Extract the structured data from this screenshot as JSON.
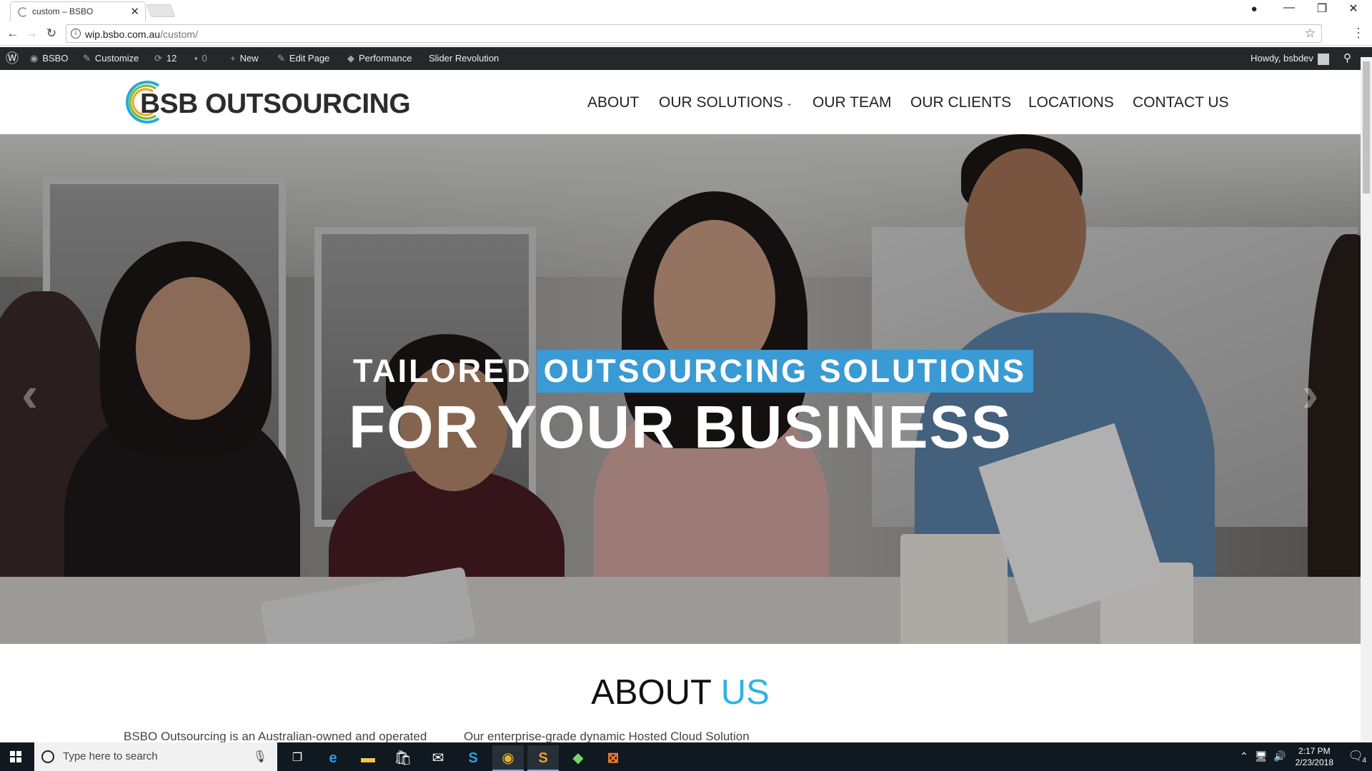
{
  "browser": {
    "tab_title": "custom – BSBO",
    "tab_close": "✕",
    "url_host": "wip.bsbo.com.au",
    "url_path": "/custom/",
    "window_controls": [
      "—",
      "❐",
      "✕"
    ]
  },
  "adminbar": {
    "site": "BSBO",
    "customize": "Customize",
    "updates": "12",
    "comments": "0",
    "new": "New",
    "edit_page": "Edit Page",
    "performance": "Performance",
    "slider_revolution": "Slider Revolution",
    "howdy": "Howdy, bsbdev"
  },
  "header": {
    "logo_text": "BSB OUTSOURCING",
    "nav": [
      "ABOUT",
      "OUR SOLUTIONS",
      "OUR TEAM",
      "OUR CLIENTS",
      "LOCATIONS",
      "CONTACT US"
    ],
    "dropdown_chevron": "⌄"
  },
  "hero": {
    "line1_prefix": "TAILORED",
    "line1_highlight": "OUTSOURCING SOLUTIONS",
    "line2": "FOR YOUR BUSINESS",
    "prev": "‹",
    "next": "›"
  },
  "about": {
    "title_part1": "ABOUT",
    "title_part2": "US",
    "col1": "BSBO Outsourcing is an Australian-owned and operated",
    "col2": "Our enterprise-grade dynamic Hosted Cloud Solution"
  },
  "taskbar": {
    "search_placeholder": "Type here to search",
    "time": "2:17 PM",
    "date": "2/23/2018",
    "notification_count": "4"
  },
  "colors": {
    "accent": "#2db4e6",
    "highlight": "#3a9ad3",
    "adminbar": "#23282d",
    "taskbar": "#101820"
  }
}
